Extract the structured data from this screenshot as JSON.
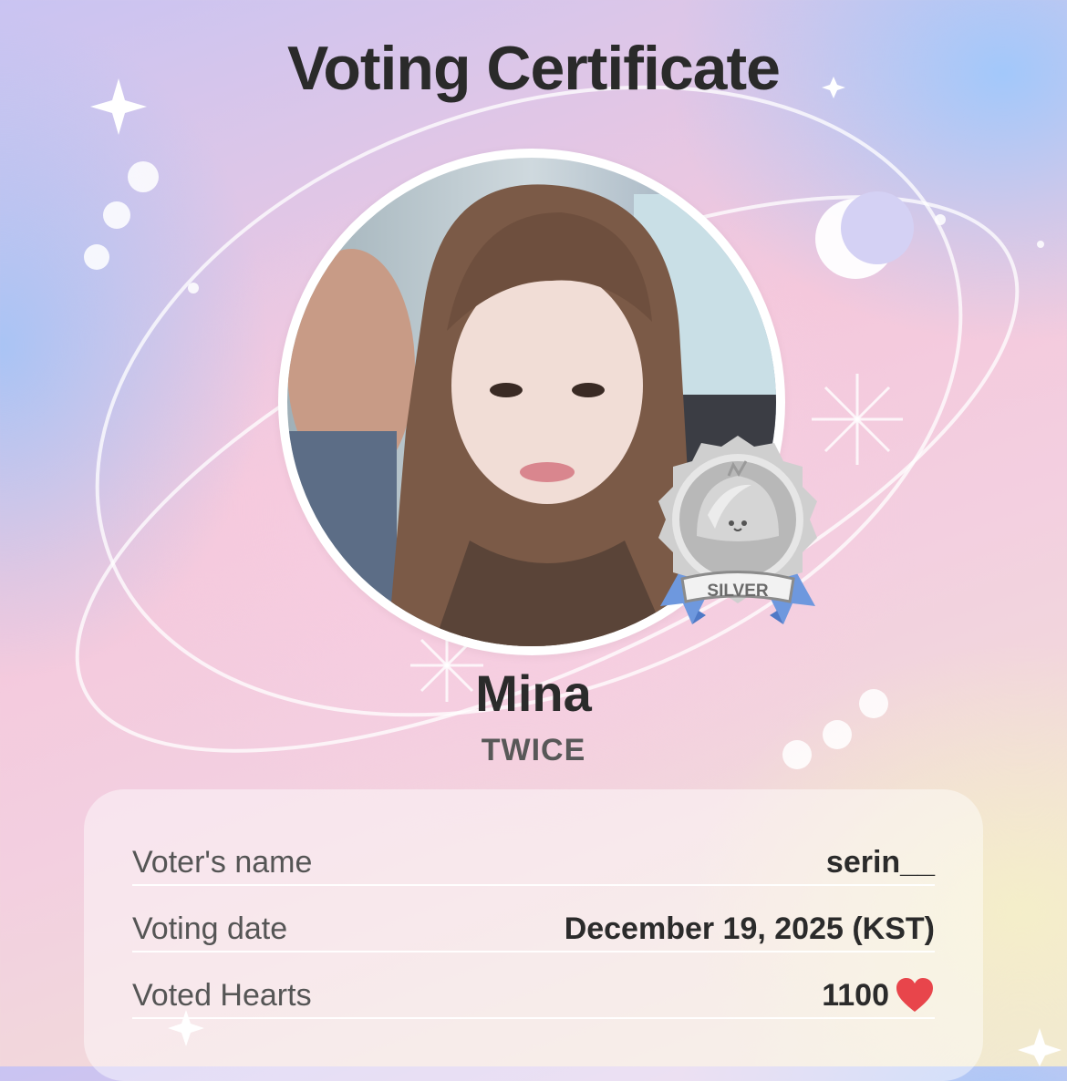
{
  "title": "Voting Certificate",
  "artist": {
    "name": "Mina",
    "group": "TWICE"
  },
  "badge": {
    "tier": "SILVER"
  },
  "details": [
    {
      "label": "Voter's name",
      "value": "serin__"
    },
    {
      "label": "Voting date",
      "value": "December 19, 2025 (KST)"
    },
    {
      "label": "Voted Hearts",
      "value": "1100",
      "icon": "heart-icon"
    }
  ],
  "colors": {
    "heart": "#e8454b",
    "badge_silver": "#c8c8c8",
    "ribbon": "#6e98de",
    "title": "#2a2a2a"
  }
}
